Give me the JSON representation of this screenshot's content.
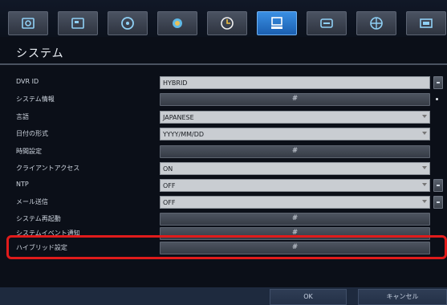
{
  "header": {
    "tabs": [
      {
        "icon": "camera-icon",
        "active": false
      },
      {
        "icon": "record-icon",
        "active": false
      },
      {
        "icon": "disc-icon",
        "active": false
      },
      {
        "icon": "network-icon",
        "active": false
      },
      {
        "icon": "clock-icon",
        "active": false
      },
      {
        "icon": "system-monitor-icon",
        "active": true
      },
      {
        "icon": "storage-icon",
        "active": false
      },
      {
        "icon": "globe-icon",
        "active": false
      },
      {
        "icon": "display-icon",
        "active": false
      }
    ],
    "accent_color": "#2a7ad0"
  },
  "page": {
    "title": "システム"
  },
  "settings": {
    "dvr_id": {
      "label": "DVR ID",
      "value": "HYBRID"
    },
    "system_info": {
      "label": "システム情報",
      "button": "#"
    },
    "language": {
      "label": "言語",
      "value": "JAPANESE"
    },
    "date_format": {
      "label": "日付の形式",
      "value": "YYYY/MM/DD"
    },
    "time_setting": {
      "label": "時間設定",
      "button": "#"
    },
    "client_access": {
      "label": "クライアントアクセス",
      "value": "ON"
    },
    "ntp": {
      "label": "NTP",
      "value": "OFF"
    },
    "mail_send": {
      "label": "メール送信",
      "value": "OFF"
    },
    "system_restart": {
      "label": "システム再起動",
      "button": "#"
    },
    "system_event": {
      "label": "システムイベント通知",
      "button": "#"
    },
    "hybrid_setting": {
      "label": "ハイブリッド設定",
      "button": "#"
    }
  },
  "footer": {
    "ok_label": "OK",
    "cancel_label": "キャンセル"
  },
  "highlight_color": "#e01b1b"
}
